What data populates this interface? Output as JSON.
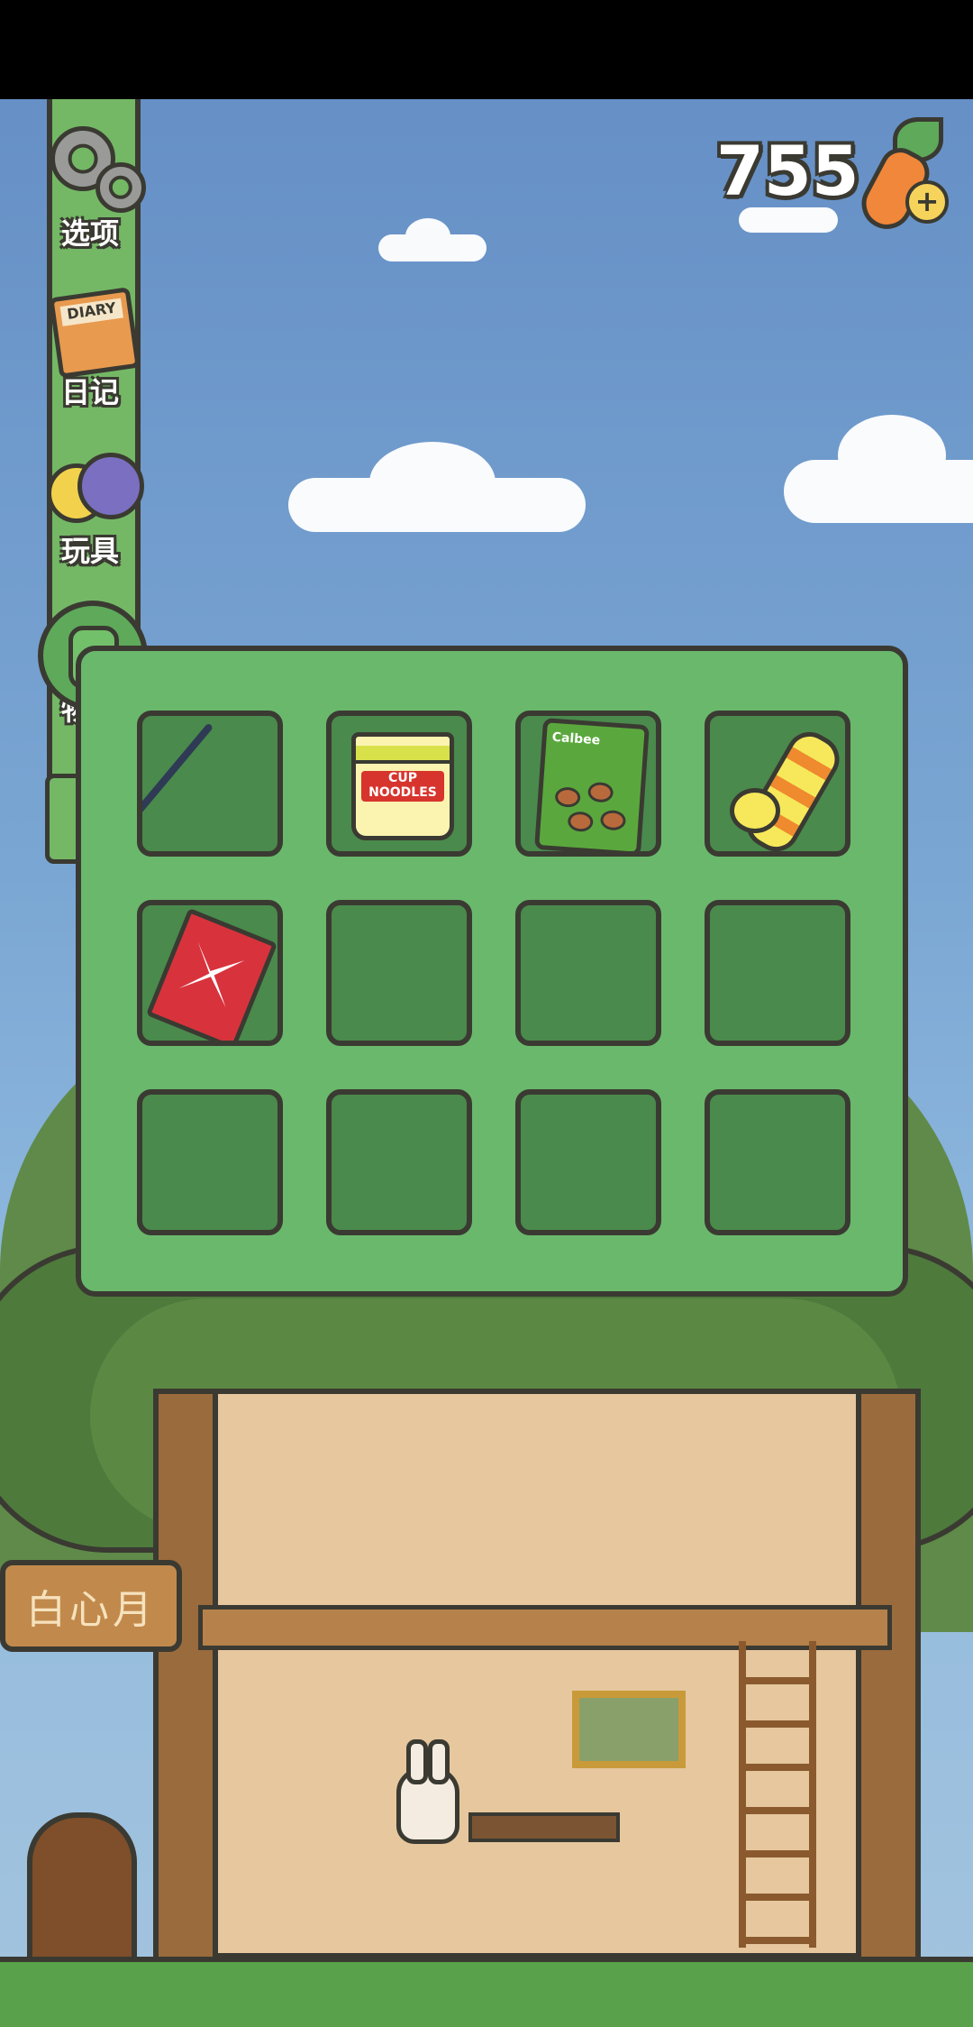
{
  "hud": {
    "carrot_count": "755",
    "carrot_add_symbol": "+"
  },
  "sidebar": {
    "items": [
      {
        "label": "选项",
        "icon": "gear-icon"
      },
      {
        "label": "日记",
        "icon": "diary-icon"
      },
      {
        "label": "玩具",
        "icon": "toy-balls-icon"
      },
      {
        "label": "物品",
        "icon": "backpack-icon"
      }
    ],
    "diary_cover_text": "DIARY"
  },
  "inventory": {
    "cup_noodle_text": "CUP NOODLES",
    "chips_brand": "Calbee",
    "slots": [
      {
        "item": "fishing-rod"
      },
      {
        "item": "cup-noodles"
      },
      {
        "item": "chips-bag"
      },
      {
        "item": "swim-ring"
      },
      {
        "item": "red-card"
      },
      {
        "item": ""
      },
      {
        "item": ""
      },
      {
        "item": ""
      },
      {
        "item": ""
      },
      {
        "item": ""
      },
      {
        "item": ""
      },
      {
        "item": ""
      }
    ]
  },
  "scene": {
    "sign_text": "白心月"
  },
  "colors": {
    "panel": "#6ab86c",
    "slot": "#4a8a4c",
    "outline": "#3a3a32",
    "sky": "#7aa6d3"
  }
}
